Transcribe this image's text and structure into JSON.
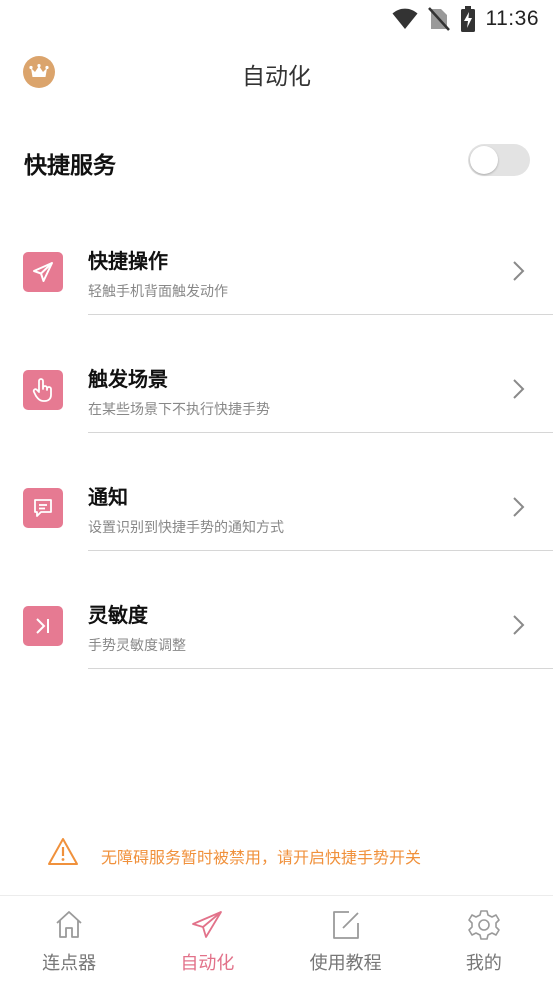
{
  "status_bar": {
    "time": "11:36",
    "icons": [
      "wifi-icon",
      "no-sim-icon",
      "battery-charging-icon"
    ]
  },
  "header": {
    "title": "自动化",
    "badge_icon": "crown-icon"
  },
  "quick_service": {
    "label": "快捷服务",
    "enabled": false
  },
  "menu": [
    {
      "icon": "send-icon",
      "title": "快捷操作",
      "subtitle": "轻触手机背面触发动作"
    },
    {
      "icon": "hand-tap-icon",
      "title": "触发场景",
      "subtitle": "在某些场景下不执行快捷手势"
    },
    {
      "icon": "message-icon",
      "title": "通知",
      "subtitle": "设置识别到快捷手势的通知方式"
    },
    {
      "icon": "skip-next-icon",
      "title": "灵敏度",
      "subtitle": "手势灵敏度调整"
    }
  ],
  "warning": {
    "icon": "warning-icon",
    "text": "无障碍服务暂时被禁用，请开启快捷手势开关"
  },
  "bottom_nav": {
    "active_index": 1,
    "tabs": [
      {
        "icon": "home-icon",
        "label": "连点器"
      },
      {
        "icon": "send-icon",
        "label": "自动化"
      },
      {
        "icon": "edit-icon",
        "label": "使用教程"
      },
      {
        "icon": "settings-icon",
        "label": "我的"
      }
    ]
  },
  "colors": {
    "accent": "#e67a92",
    "active_tab": "#e2728a",
    "warning": "#f0913c",
    "badge": "#dba46c"
  }
}
